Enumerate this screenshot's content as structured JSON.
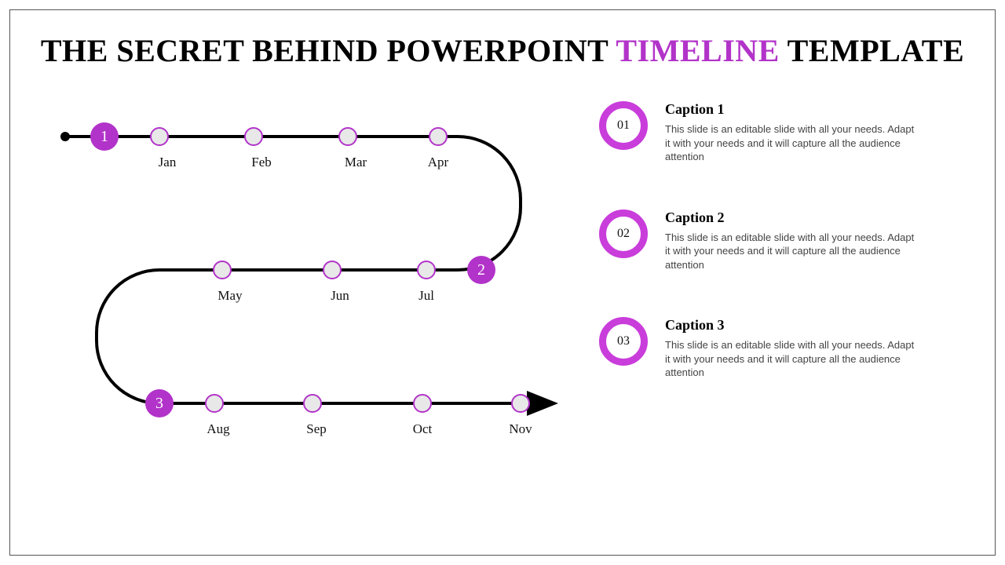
{
  "title": {
    "prefix": "THE SECRET BEHIND POWERPOINT ",
    "accent": "TIMELINE",
    "suffix": " TEMPLATE"
  },
  "timeline": {
    "row1": {
      "marker": "1",
      "months": [
        "Jan",
        "Feb",
        "Mar",
        "Apr"
      ]
    },
    "row2": {
      "marker": "2",
      "months": [
        "May",
        "Jun",
        "Jul"
      ]
    },
    "row3": {
      "marker": "3",
      "months": [
        "Aug",
        "Sep",
        "Oct",
        "Nov"
      ]
    }
  },
  "captions": [
    {
      "num": "01",
      "title": "Caption 1",
      "body": "This slide is an editable slide with all your needs. Adapt it with your needs and it will capture all the audience attention"
    },
    {
      "num": "02",
      "title": "Caption 2",
      "body": "This slide is an editable slide with all your needs. Adapt it with your needs and it will capture all the audience attention"
    },
    {
      "num": "03",
      "title": "Caption 3",
      "body": "This slide is an editable slide with all your needs. Adapt it with your needs and it will capture all the audience attention"
    }
  ],
  "colors": {
    "accent": "#b233c9",
    "ring": "#c93ddb"
  }
}
